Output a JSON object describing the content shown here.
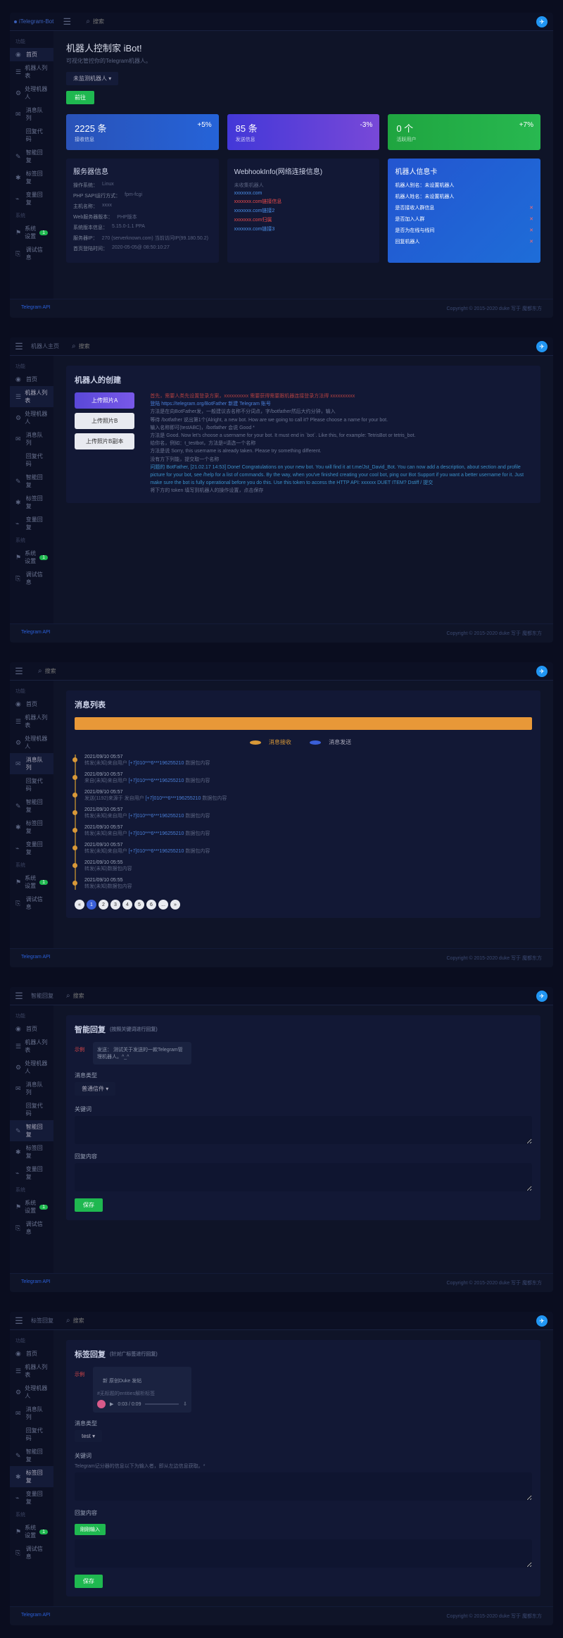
{
  "common": {
    "brand": "iTelegram-Bot",
    "search_placeholder": "搜索",
    "footer_left": "Telegram API",
    "footer_right": "Copyright © 2015-2020 duke 写于 魔都东方"
  },
  "sidebar": {
    "g1": "功能",
    "items": [
      "首页",
      "机器人列表",
      "处理机器人",
      "消息队列",
      "回复代码",
      "智能回复",
      "标签回复",
      "变量回复"
    ],
    "g2": "系统",
    "items2": [
      "系统设置",
      "调试信息"
    ],
    "badge": "1"
  },
  "s1": {
    "title": "机器人控制家 iBot!",
    "subtitle": "可视化管控你的Telegram机器人。",
    "no_bot": "未监测机器人",
    "go": "前往",
    "stats": [
      {
        "val": "2225 条",
        "lbl": "接收信息",
        "pct": "+5%"
      },
      {
        "val": "85 条",
        "lbl": "发送信息",
        "pct": "-3%"
      },
      {
        "val": "0 个",
        "lbl": "活跃用户",
        "pct": "+7%"
      }
    ],
    "server": {
      "title": "服务器信息",
      "lines": [
        [
          "操作系统：",
          "Linux"
        ],
        [
          "PHP SAPI运行方式：",
          "fpm-fcgi"
        ],
        [
          "主机名称：",
          "xxxx"
        ],
        [
          "Web服务器版本：",
          "PHP版本"
        ],
        [
          "系统版本信息：",
          "5.15.0-1.1 PPA"
        ],
        [
          "服务器IP：",
          "270 (serverknown.com) 当前访问IP(99.180.50.2)"
        ],
        [
          "首页登陆时间：",
          "2020-05-05@ 08:50:10:27"
        ]
      ]
    },
    "webhook": {
      "title": "WebhookInfo(网络连接信息)",
      "sub": "未收集机器人",
      "links": [
        "xxxxxxx.com",
        "xxxxxxx.com链接信息",
        "xxxxxxx.com链接2",
        "xxxxxxx.com归属",
        "xxxxxxx.com链接3"
      ]
    },
    "botinfo": {
      "title": "机器人信息卡",
      "alias": "机器人别名：未设置机器人",
      "name": "机器人姓名：未设置机器人",
      "rows": [
        "是否接收人群信息",
        "是否加入人群",
        "是否为在线与线间",
        "回复机器人"
      ]
    }
  },
  "s2": {
    "title": "机器人的创建",
    "btns": [
      "上传照片A",
      "上传照片B",
      "上传照片B副本"
    ],
    "log": [
      {
        "t": "首先，需要人类先设置登录方案，xxxxxxxxxx 需要获得需要跟机器连接登录方法得 xxxxxxxxxx",
        "red": true
      },
      {
        "t": "登陆 https://telegram.org/BotFather 新建 Telegram 账号",
        "link": true
      },
      {
        "t": "方法是在向BotFather发，一般建议去名称不分词点，字/botfather然后大约分钟，输入 "
      },
      {
        "t": "等待 /botfather 说出第1个(Alright, a new bot. How are we going to call it? Please choose a name for your bot."
      },
      {
        "t": "输入名称即可(testABC)，/botfather 会说 Good *"
      },
      {
        "t": "方法是 Good. Now let's choose a username for your bot. It must end in `bot`. Like this, for example: TetrisBot or tetris_bot."
      },
      {
        "t": "给你名，例如：t_testbot，方法是=请选一个名称"
      },
      {
        "t": "方法是说 Sorry, this username is already taken. Please try something different."
      },
      {
        "t": "没有方下列能，提交取一个名称"
      },
      {
        "t": "问题的 BotFather, [21.02.17 14:53] Done! Congratulations on your new bot. You will find it at t.me/Jst_David_Bot. You can now add a description, about section and profile picture for your bot, see /help for a list of commands. By the way, when you've finished creating your cool bot, ping our Bot Support if you want a better username for it. Just make sure the bot is fully operational before you do this. Use this token to access the HTTP API: xxxxxx DUET ITEM? Dstiff / 提交",
        "cyan": true
      },
      {
        "t": "将下方的 token 填写到机器人的操作设置，点击保存"
      }
    ]
  },
  "s3": {
    "title": "消息列表",
    "tabs": [
      "消息接收",
      "消息发送"
    ],
    "msgs": [
      {
        "d": "2021/09/10 05:57",
        "t": "转发(未知)来自用户 [+7]010***6***196255210 数据包内容"
      },
      {
        "d": "2021/09/10 05:57",
        "t": "来自(未知)来自用户 [+7]010***6***196255210 数据包内容"
      },
      {
        "d": "2021/09/10 05:57",
        "t": "发送(1192)来源于 发自用户 [+7]010***6***196255210 数据包内容"
      },
      {
        "d": "2021/09/10 05:57",
        "t": "转发(未知)来自用户 [+7]010***6***196255210 数据包内容"
      },
      {
        "d": "2021/09/10 05:57",
        "t": "转发(未知)来自用户 [+7]010***6***196255210 数据包内容"
      },
      {
        "d": "2021/09/10 05:57",
        "t": "转发(未知)来自用户 [+7]010***6***196255210 数据包内容"
      },
      {
        "d": "2021/09/10 05:55",
        "t": "转发(未知)数据包内容"
      },
      {
        "d": "2021/09/10 05:55",
        "t": "转发(未知)数据包内容"
      }
    ],
    "pages": [
      "«",
      "1",
      "2",
      "3",
      "4",
      "5",
      "6",
      "...",
      "»"
    ]
  },
  "s4": {
    "title": "智能回复",
    "sub": "(按照关键词进行回复)",
    "demo_label": "示例",
    "demo_text": "发送： 测试关于发送的一款Telegram管理机器人。^_^",
    "f1": "消息类型",
    "f1v": "普通信件",
    "f2": "关键词",
    "f3": "回复内容",
    "save": "保存"
  },
  "s5": {
    "title": "标签回复",
    "sub": "(针对广标签进行回复)",
    "tag_demo": "新 原创Duke   发帖",
    "entity": "#无标题的entities解析标签",
    "play": "0:03 / 0:09",
    "f1": "消息类型",
    "f1v": "test",
    "f2": "关键词",
    "f2hint": "Telegram记分器的信息以下为输入者，即从左边信息获取。*",
    "f3": "回复内容",
    "f3v": "刚刚输入",
    "save": "保存"
  }
}
